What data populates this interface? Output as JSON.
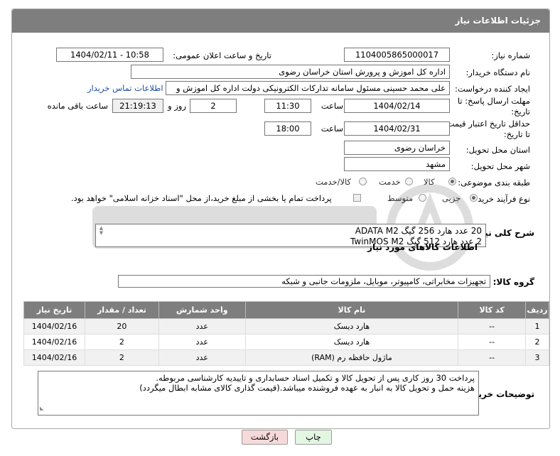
{
  "header": {
    "title": "جزئیات اطلاعات نیاز"
  },
  "need_number": {
    "label": "شماره نیاز:",
    "value": "1104005865000017"
  },
  "announce": {
    "label": "تاریخ و ساعت اعلان عمومی:",
    "value": "1404/02/11 - 10:58"
  },
  "buyer_org": {
    "label": "نام دستگاه خریدار:",
    "value": "اداره کل اموزش و پرورش استان خراسان رضوی"
  },
  "requester": {
    "label": "ایجاد کننده درخواست:",
    "value": "علی محمد حسینی مسئول سامانه تدارکات الکترونیکی دولت اداره کل اموزش و",
    "contact_link": "اطلاعات تماس خریدار"
  },
  "deadline": {
    "label_line1": "مهلت ارسال پاسخ: تا",
    "label_line2": "تاریخ:",
    "date": "1404/02/14",
    "time_label": "ساعت",
    "time": "11:30",
    "days": "2",
    "days_label": "روز و",
    "remaining": "21:19:13",
    "remaining_label": "ساعت باقی مانده"
  },
  "price_validity": {
    "label_line1": "حداقل تاریخ اعتبار قیمت:",
    "label_line2": "تا تاریخ:",
    "date": "1404/02/31",
    "time_label": "ساعت",
    "time": "18:00"
  },
  "delivery_province": {
    "label": "استان محل تحویل:",
    "value": "خراسان رضوی"
  },
  "delivery_city": {
    "label": "شهر محل تحویل:",
    "value": "مشهد"
  },
  "category": {
    "label": "طبقه بندی موضوعی:",
    "options": [
      "کالا",
      "خدمت",
      "کالا/خدمت"
    ],
    "selected": "کالا"
  },
  "purchase_type": {
    "label": "نوع فرآیند خرید :",
    "options": [
      "جزیی",
      "متوسط"
    ],
    "selected": "جزیی",
    "treasury_note": "پرداخت تمام یا بخشی از مبلغ خرید،از محل \"اسناد خزانه اسلامی\" خواهد بود."
  },
  "description": {
    "label": "شرح کلی نیاز:",
    "line1": "20 عدد هارد 256 گیگ ADATA M2",
    "line2": "2 عدد هارد 512 گیگ TwinMOS M2"
  },
  "goods_info": {
    "title": "اطلاعات کالاهای مورد نیاز"
  },
  "goods_group": {
    "label": "گروه کالا:",
    "value": "تجهیزات مخابراتی، کامپیوتر، موبایل، ملزومات جانبی و شبکه"
  },
  "table": {
    "headers": [
      "ردیف",
      "کد کالا",
      "نام کالا",
      "واحد شمارش",
      "تعداد / مقدار",
      "تاریخ نیاز"
    ],
    "rows": [
      {
        "idx": "1",
        "code": "--",
        "name": "هارد دیسک",
        "unit": "عدد",
        "qty": "20",
        "date": "1404/02/16"
      },
      {
        "idx": "2",
        "code": "--",
        "name": "هارد دیسک",
        "unit": "عدد",
        "qty": "2",
        "date": "1404/02/16"
      },
      {
        "idx": "3",
        "code": "--",
        "name": "ماژول حافظه رم (RAM)",
        "unit": "عدد",
        "qty": "2",
        "date": "1404/02/16"
      }
    ]
  },
  "buyer_notes": {
    "label": "توضیحات خریدار:",
    "line1": "پرداخت 30 روز کاری پس از تحویل کالا و تکمیل اسناد حسابداری و تاییدیه کارشناسی مربوطه.",
    "line2": "هزینه حمل و تحویل کالا به انبار به عهده فروشنده میباشد.(قیمت گذاری کالای مشابه ابطال میگردد)"
  },
  "buttons": {
    "print": "چاپ",
    "back": "بازگشت"
  },
  "colors": {
    "header_bg": "#7e7e7e",
    "link": "#1f4f9e",
    "back_bg": "#f6d9d9",
    "print_bg": "#e2f6e2"
  }
}
